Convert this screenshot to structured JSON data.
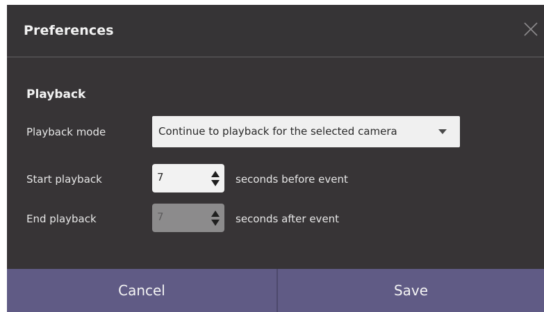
{
  "dialog": {
    "title": "Preferences",
    "close_icon": "close-icon"
  },
  "section": {
    "title": "Playback"
  },
  "playback_mode": {
    "label": "Playback mode",
    "selected": "Continue to playback for the selected camera",
    "caret_icon": "caret-down-icon"
  },
  "start_playback": {
    "label": "Start playback",
    "value": "7",
    "suffix": "seconds before event",
    "enabled": true
  },
  "end_playback": {
    "label": "End playback",
    "value": "7",
    "suffix": "seconds after event",
    "enabled": false
  },
  "footer": {
    "cancel_label": "Cancel",
    "save_label": "Save"
  },
  "colors": {
    "background": "#373436",
    "footer": "#605b85",
    "text": "#f2f2f2"
  }
}
